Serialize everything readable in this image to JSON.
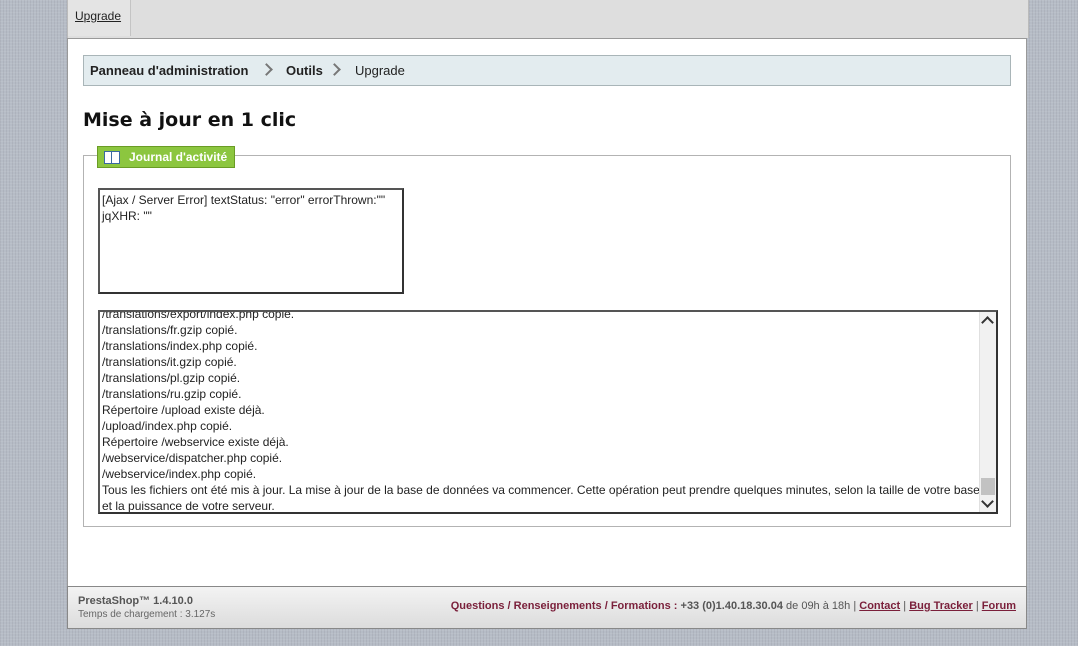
{
  "tabs": [
    {
      "label": "Upgrade"
    }
  ],
  "breadcrumb": {
    "items": [
      "Panneau d'administration",
      "Outils",
      "Upgrade"
    ]
  },
  "page_title": "Mise à jour en 1 clic",
  "activity": {
    "legend": "Journal d'activité",
    "error_text": "[Ajax / Server Error] textStatus: \"error\" errorThrown:\"\" jqXHR: \"\"",
    "log_lines": [
      "/translations/export/index.php copié.",
      "/translations/fr.gzip copié.",
      "/translations/index.php copié.",
      "/translations/it.gzip copié.",
      "/translations/pl.gzip copié.",
      "/translations/ru.gzip copié.",
      "Répertoire /upload existe déjà.",
      "/upload/index.php copié.",
      "Répertoire /webservice existe déjà.",
      "/webservice/dispatcher.php copié.",
      "/webservice/index.php copié.",
      "Tous les fichiers ont été mis à jour. La mise à jour de la base de données va commencer. Cette opération peut prendre quelques minutes, selon la taille de votre base et la puissance de votre serveur."
    ]
  },
  "footer": {
    "brand": "PrestaShop™ 1.4.10.0",
    "load_time": "Temps de chargement : 3.127s",
    "questions": "Questions / Renseignements / Formations :",
    "phone": "+33 (0)1.40.18.30.04",
    "hours": "de 09h à 18h",
    "links": [
      "Contact",
      "Bug Tracker",
      "Forum"
    ]
  }
}
